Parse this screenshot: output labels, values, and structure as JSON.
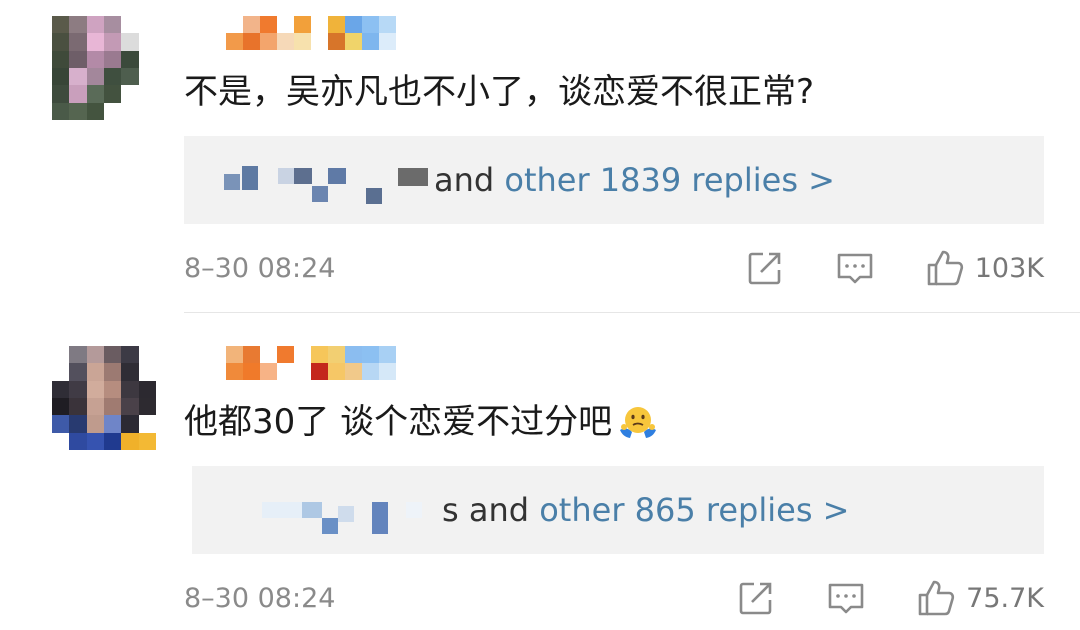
{
  "comments": [
    {
      "text": "不是，吴亦凡也不小了，谈恋爱不很正常?",
      "replies_suffix": "and ",
      "replies_link": "other 1839 replies >",
      "timestamp": "8–30 08:24",
      "likes": "103K"
    },
    {
      "text": "他都30了 谈个恋爱不过分吧",
      "emoji": "shrugging-face-emoji",
      "replies_suffix": "s and ",
      "replies_link": "other 865 replies >",
      "timestamp": "8–30 08:24",
      "likes": "75.7K"
    }
  ],
  "colors": {
    "link": "#4a7fa8",
    "reply_box": "#f2f2f2",
    "meta_text": "#8a8a8a"
  },
  "icons": [
    "share-icon",
    "reply-icon",
    "thumbs-up-icon"
  ]
}
